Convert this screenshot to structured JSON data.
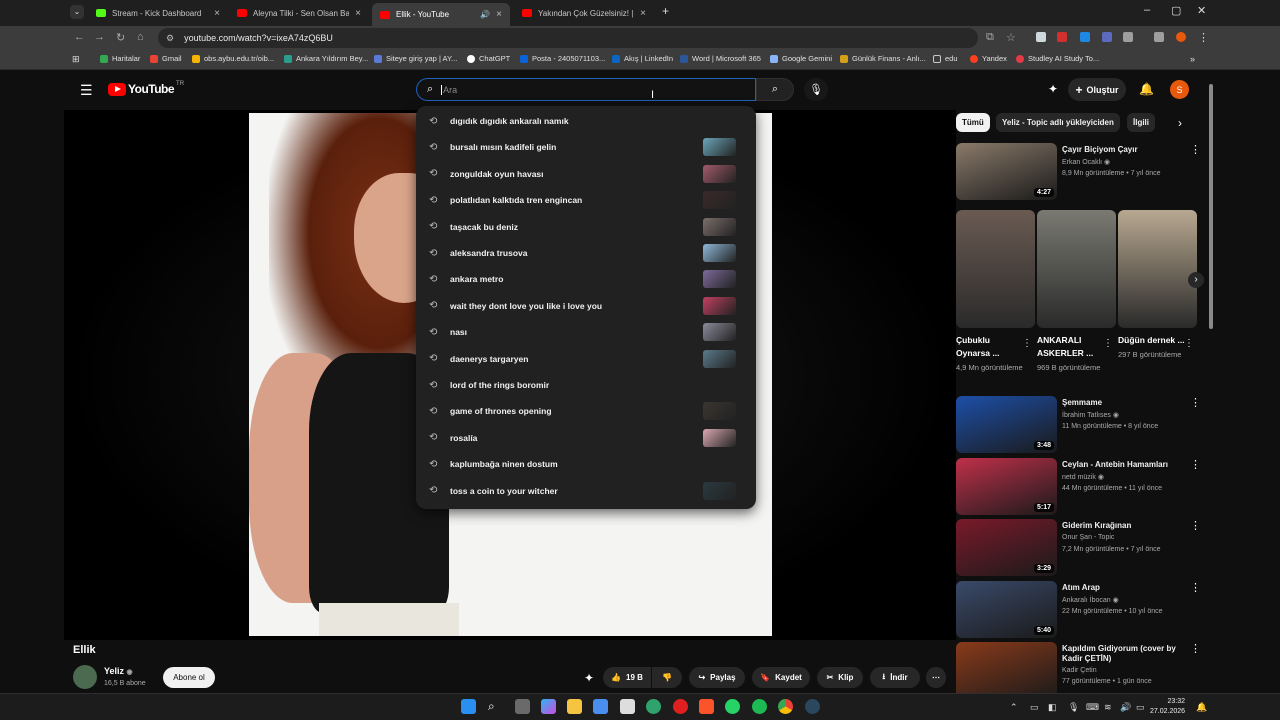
{
  "browser": {
    "tabs": [
      {
        "title": "Stream - Kick Dashboard",
        "color": "#53fc18"
      },
      {
        "title": "Aleyna Tilki - Sen Olsan Bari (8...",
        "color": "#ff0000"
      },
      {
        "title": "Ellik - YouTube",
        "color": "#ff0000"
      },
      {
        "title": "Yakından Çok Güzelsiniz! | Mar...",
        "color": "#ff0000"
      }
    ],
    "url": "youtube.com/watch?v=ixeA74zQ6BU",
    "bookmarks": [
      {
        "label": "Haritalar",
        "color": "#34a853"
      },
      {
        "label": "Gmail",
        "color": "#ea4335"
      },
      {
        "label": "obs.aybu.edu.tr/oib...",
        "color": "#f4b400"
      },
      {
        "label": "Ankara Yıldırım Bey...",
        "color": "#2a9d8f"
      },
      {
        "label": "Siteye giriş yap | AY...",
        "color": "#5b7ad8"
      },
      {
        "label": "ChatGPT",
        "color": "#ffffff"
      },
      {
        "label": "Posta - 2405071103...",
        "color": "#0a64d8"
      },
      {
        "label": "Akış | LinkedIn",
        "color": "#0a66c2"
      },
      {
        "label": "Word | Microsoft 365",
        "color": "#2b579a"
      },
      {
        "label": "Google Gemini",
        "color": "#8ab4f8"
      },
      {
        "label": "Günlük Finans - Anlı...",
        "color": "#d4a017"
      },
      {
        "label": "edu",
        "color": "#c8c8c8"
      },
      {
        "label": "Yandex",
        "color": "#fc3f1d"
      },
      {
        "label": "Studley AI Study To...",
        "color": "#e63946"
      }
    ]
  },
  "youtube": {
    "logo_text": "YouTube",
    "region": "TR",
    "search_placeholder": "Ara",
    "create_label": "Oluştur",
    "avatar_letter": "S",
    "suggestions": [
      {
        "text": "dıgıdık dıgıdık ankaralı namık",
        "thumb": null
      },
      {
        "text": "bursalı mısın kadifeli gelin",
        "thumb": "#6aa6b8"
      },
      {
        "text": "zonguldak oyun havası",
        "thumb": "#a15a6a"
      },
      {
        "text": "polatlıdan kalktıda tren engincan",
        "thumb": "#3a2a2a"
      },
      {
        "text": "taşacak bu deniz",
        "thumb": "#7a6e6a"
      },
      {
        "text": "aleksandra trusova",
        "thumb": "#8fb8d8"
      },
      {
        "text": "ankara metro",
        "thumb": "#7d6a9a"
      },
      {
        "text": "wait they dont love you like i love you",
        "thumb": "#c04060"
      },
      {
        "text": "nası",
        "thumb": "#8a8a9a"
      },
      {
        "text": "daenerys targaryen",
        "thumb": "#5a7a8a"
      },
      {
        "text": "lord of the rings boromir",
        "thumb": null
      },
      {
        "text": "game of thrones opening",
        "thumb": "#3a3530"
      },
      {
        "text": "rosalía",
        "thumb": "#d8a8b0"
      },
      {
        "text": "kaplumbağa ninen dostum",
        "thumb": null
      },
      {
        "text": "toss a coin to your witcher",
        "thumb": "#2a3a40"
      }
    ],
    "chips": [
      "Tümü",
      "Yeliz - Topic adlı yükleyiciden",
      "İlgili"
    ],
    "recommended": [
      {
        "title": "Çayır Biçiyom Çayır",
        "channel": "Erkan Ocaklı",
        "verified": true,
        "meta": "8,9 Mn görüntüleme • 7 yıl önce",
        "duration": "4:27",
        "thumb": "#8a7a6a"
      },
      {
        "title": "Şemmame",
        "channel": "İbrahim Tatlıses",
        "verified": true,
        "meta": "11 Mn görüntüleme • 8 yıl önce",
        "duration": "3:48",
        "thumb": "#1d4fa8"
      },
      {
        "title": "Ceylan - Antebin Hamamları",
        "channel": "netd müzik",
        "verified": true,
        "meta": "44 Mn görüntüleme • 11 yıl önce",
        "duration": "5:17",
        "thumb": "#c0304a"
      },
      {
        "title": "Giderim Kırağınan",
        "channel": "Onur Şan - Topic",
        "verified": false,
        "meta": "7,2 Mn görüntüleme • 7 yıl önce",
        "duration": "3:29",
        "thumb": "#7a1a2a"
      },
      {
        "title": "Atım Arap",
        "channel": "Ankaralı İbocan",
        "verified": true,
        "meta": "22 Mn görüntüleme • 10 yıl önce",
        "duration": "5:40",
        "thumb": "#3a4a6a"
      },
      {
        "title": "Kapıldım Gidiyorum (cover by Kadir ÇETİN)",
        "channel": "Kadir Çetin",
        "verified": false,
        "meta": "77 görüntüleme • 1 gün önce",
        "duration": "",
        "thumb": "#8a3a1a"
      }
    ],
    "shorts": [
      {
        "title": "Çubuklu Oynarsa ...",
        "views": "4,9 Mn görüntüleme",
        "thumb": "#6a5a52"
      },
      {
        "title": "ANKARALI ASKERLER ...",
        "views": "969 B görüntüleme",
        "thumb": "#7a7a72"
      },
      {
        "title": "Düğün dernek ...",
        "views": "297 B görüntüleme",
        "thumb": "#b8a890"
      }
    ],
    "video": {
      "title": "Ellik",
      "channel": "Yeliz",
      "subscribers": "16,5 B abone",
      "subscribe_label": "Abone ol",
      "likes": "19 B",
      "share_label": "Paylaş",
      "save_label": "Kaydet",
      "clip_label": "Klip",
      "download_label": "İndir"
    }
  },
  "taskbar": {
    "time": "23:32",
    "date": "27.02.2026"
  }
}
